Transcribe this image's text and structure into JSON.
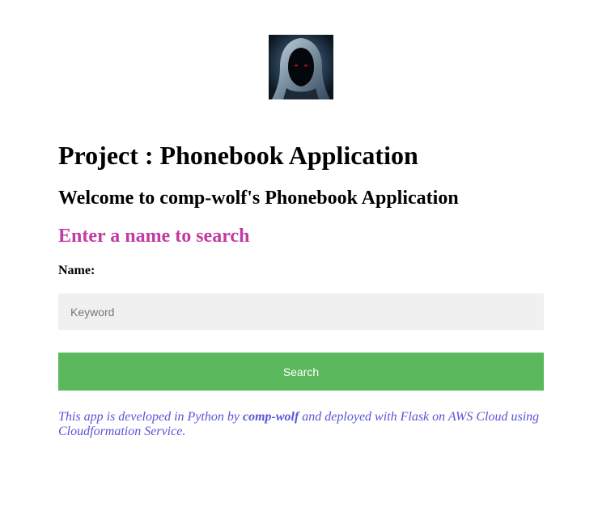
{
  "logo": {
    "icon": "hooded-figure-avatar"
  },
  "header": {
    "title": "Project : Phonebook Application",
    "welcome": "Welcome to comp-wolf's Phonebook Application",
    "prompt": "Enter a name to search"
  },
  "form": {
    "name_label": "Name:",
    "keyword_placeholder": "Keyword",
    "search_label": "Search"
  },
  "footer": {
    "text_before": "This app is developed in Python by ",
    "author": "comp-wolf",
    "text_after": " and deployed with Flask on AWS Cloud using Cloudformation Service."
  },
  "colors": {
    "prompt": "#c13ba4",
    "button": "#5cb85c",
    "input_background": "#f0f0f0",
    "footer_text": "#5a54d6"
  }
}
